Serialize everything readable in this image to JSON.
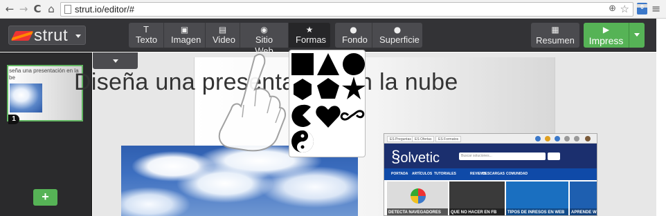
{
  "browser": {
    "url": "strut.io/editor/#",
    "back_glyph": "←",
    "forward_glyph": "→",
    "reload_glyph": "C",
    "home_glyph": "⌂",
    "zoom_glyph": "⊕",
    "star_glyph": "☆",
    "menu_glyph": "≡",
    "ext_badge": "0"
  },
  "app": {
    "logo_text": "strut",
    "toolbar": {
      "insert": [
        {
          "label": "Texto",
          "icon": "text-icon",
          "glyph": "T"
        },
        {
          "label": "Imagen",
          "icon": "image-icon",
          "glyph": "▣"
        },
        {
          "label": "Video",
          "icon": "film-icon",
          "glyph": "▤"
        },
        {
          "label": "Sitio Web",
          "icon": "globe-icon",
          "glyph": "◉"
        },
        {
          "label": "Formas",
          "icon": "star-icon",
          "glyph": "★"
        }
      ],
      "style": [
        {
          "label": "Fondo",
          "icon": "drop-icon",
          "glyph": "●"
        },
        {
          "label": "Superficie",
          "icon": "drop-icon",
          "glyph": "●"
        }
      ],
      "resumen_label": "Resumen",
      "resumen_glyph": "▦",
      "impress_label": "Impress",
      "impress_glyph": "▶"
    },
    "sidebar": {
      "thumb_text": "seña una presentación en la be",
      "slide_number": "1",
      "add_label": "+"
    },
    "slide": {
      "title": "Diseña una presentación en la nube"
    },
    "embedded_site": {
      "logo": "olvetic",
      "search_placeholder": "Buscar soluciones...",
      "tabs": [
        "ES Preguntas",
        "ES Ofertas",
        "ES Formatos"
      ],
      "nav": [
        "PORTADA",
        "ARTÍCULOS",
        "TUTORIALES",
        "REVIEWS",
        "DESCARGAS",
        "COMUNIDAD"
      ],
      "cards": [
        "DETECTA NAVEGADORES",
        "QUE NO HACER EN FB",
        "TIPOS DE INRESOS EN WEB",
        "APRENDE WI"
      ]
    },
    "accent": "#56b356",
    "toolbar_bg": "#333336"
  }
}
